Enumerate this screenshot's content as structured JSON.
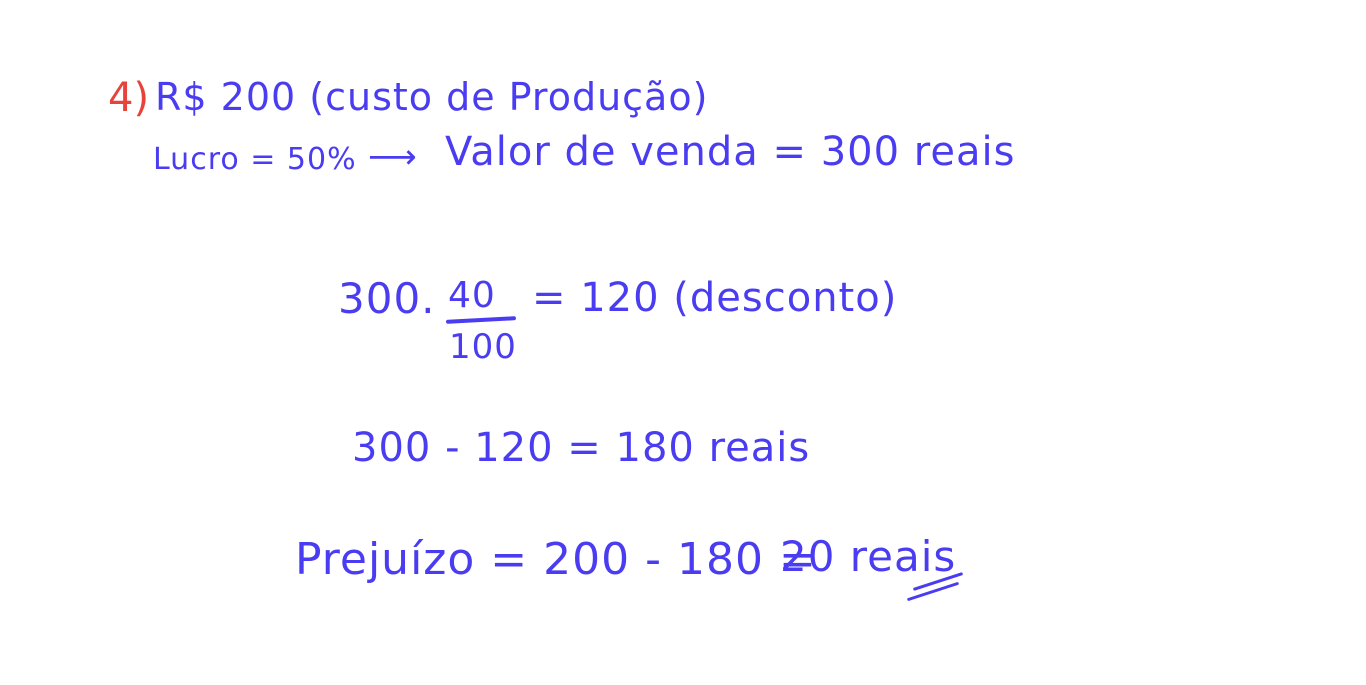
{
  "problem": {
    "number": "4)",
    "line1": "R$ 200 (custo de Produção)",
    "line2_left": "Lucro = 50%",
    "arrow": "⟶",
    "line2_right": "Valor de venda = 300 reais"
  },
  "calculation": {
    "whole": "300.",
    "dot": "·",
    "numerator": "40",
    "denominator": "100",
    "result": "= 120 (desconto)"
  },
  "subtraction": "300 - 120 = 180 reais",
  "loss": {
    "expression": "Prejuízo = 200 - 180 =",
    "answer": "20 reais"
  },
  "colors": {
    "ink": "#4a3cf0",
    "number_red": "#e8433b",
    "background": "#ffffff"
  }
}
